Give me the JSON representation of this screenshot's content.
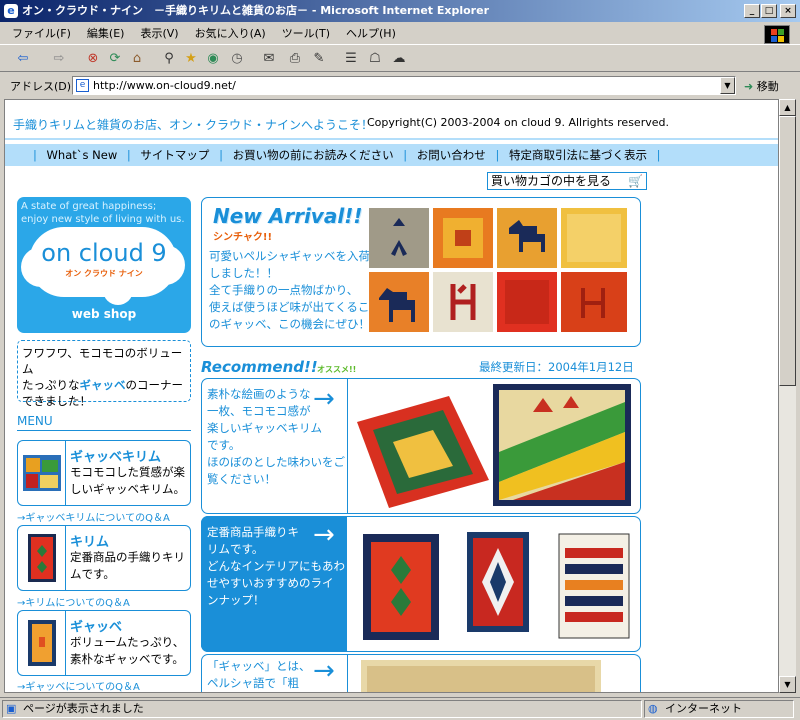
{
  "window": {
    "title": "オン・クラウド・ナイン　－手織りキリムと雑貨のお店－ - Microsoft Internet Explorer",
    "minimize": "_",
    "maximize": "□",
    "close": "×"
  },
  "menu": [
    "ファイル(F)",
    "編集(E)",
    "表示(V)",
    "お気に入り(A)",
    "ツール(T)",
    "ヘルプ(H)"
  ],
  "address": {
    "label": "アドレス(D)",
    "url": "http://www.on-cloud9.net/",
    "go": "移動"
  },
  "status": {
    "left": "ページが表示されました",
    "zone": "インターネット"
  },
  "page": {
    "welcome": "手織りキリムと雑貨のお店、オン・クラウド・ナインへようこそ！",
    "copyright": "Copyright(C) 2003-2004 on cloud 9. Allrights reserved.",
    "nav": [
      "What`s New",
      "サイトマップ",
      "お買い物の前にお読みください",
      "お問い合わせ",
      "特定商取引法に基づく表示"
    ],
    "cart": "買い物カゴの中を見る",
    "logo": {
      "tagline1": "A state of great happiness;",
      "tagline2": "enjoy new style of living with us.",
      "name": "on cloud 9",
      "kana": "オン クラウド ナイン",
      "webshop": "web shop"
    },
    "promo": {
      "line1": "フワフワ、モコモコのボリューム",
      "line2a": "たっぷりな",
      "line2b": "ギャッベ",
      "line2c": "のコーナー",
      "line3": "できました！"
    },
    "menu_heading": "MENU",
    "menu_items": [
      {
        "title": "ギャッベキリム",
        "desc": "モコモコした質感が楽しいギャッベキリム。",
        "qa": "→ギャッベキリムについてのQ＆A"
      },
      {
        "title": "キリム",
        "desc": "定番商品の手織りキリムです。",
        "qa": "→キリムについてのQ＆A"
      },
      {
        "title": "ギャッベ",
        "desc": "ボリュームたっぷり、素朴なギャッベです。",
        "qa": "→ギャッベについてのQ＆A"
      }
    ],
    "new_arrival": {
      "title": "New Arrival!!",
      "sub": "シンチャク!!",
      "text": [
        "可愛いペルシャギャッベを入荷",
        "しました！！",
        "全て手織りの一点物ばかり、",
        "使えば使うほど味が出てくるこ",
        "のギャッベ、この機会にぜひ！"
      ]
    },
    "recommend": {
      "title": "Recommend!!",
      "sub": "オススメ!!",
      "updated": "最終更新日：2004年1月12日"
    },
    "rec1": [
      "素朴な絵画のような",
      "一枚、モコモコ感が",
      "楽しいギャッベキリム",
      "です。",
      "ほのぼのとした味わいをご",
      "覧ください！"
    ],
    "rec2": [
      "定番商品手織りキ",
      "リムです。",
      "どんなインテリアにもあわ",
      "せやすいおすすめのライ",
      "ンナップ！"
    ],
    "rec3": [
      "「ギャッベ」とは、",
      "ペルシャ語で「粗"
    ]
  },
  "colors": {
    "accent": "#1a8fd8",
    "nav_bg": "#b3defa",
    "logo_bg": "#2ba7e8",
    "orange": "#e8600c"
  }
}
